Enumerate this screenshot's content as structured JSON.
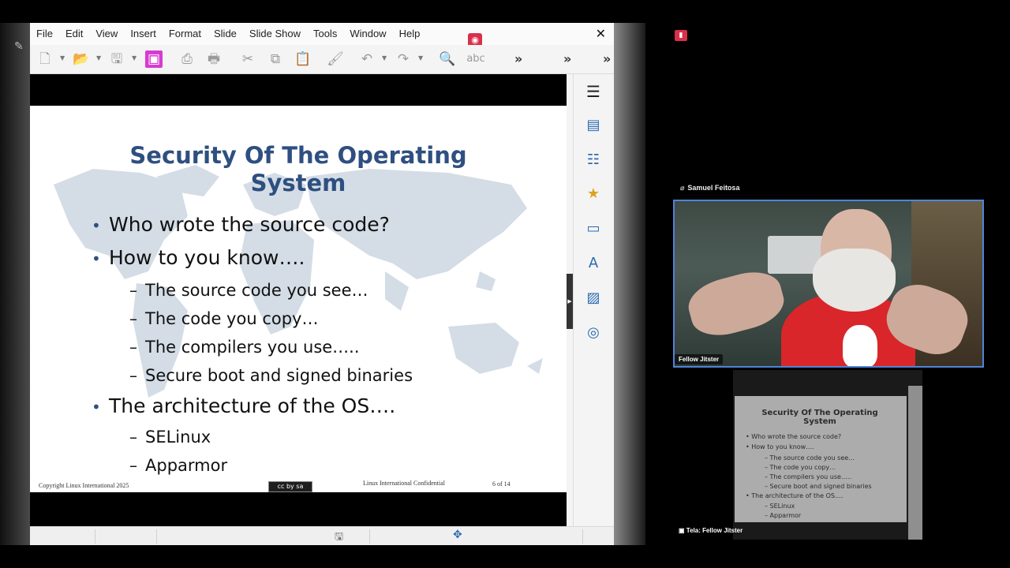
{
  "menubar": {
    "items": [
      "File",
      "Edit",
      "View",
      "Insert",
      "Format",
      "Slide",
      "Slide Show",
      "Tools",
      "Window",
      "Help"
    ],
    "close_glyph": "✕"
  },
  "toolbar": {
    "more_glyph": "»",
    "icons": [
      "new-icon",
      "open-folder-icon",
      "save-icon",
      "template-icon",
      "export-pdf-icon",
      "print-icon",
      "cut-icon",
      "copy-icon",
      "paste-icon",
      "clone-formatting-icon",
      "undo-icon",
      "redo-icon",
      "find-replace-icon",
      "spelling-icon"
    ],
    "spelling_text": "abc"
  },
  "slide": {
    "title": "Security Of The Operating System",
    "bullets": [
      {
        "level": 1,
        "text": "Who wrote the source code?"
      },
      {
        "level": 1,
        "text": "How to you know…."
      },
      {
        "level": 2,
        "text": "The  source code you see…"
      },
      {
        "level": 2,
        "text": "The code you copy…"
      },
      {
        "level": 2,
        "text": "The compilers you use….."
      },
      {
        "level": 2,
        "text": "Secure boot and signed binaries"
      },
      {
        "level": 1,
        "text": "The architecture of the OS…."
      },
      {
        "level": 2,
        "text": "SELinux"
      },
      {
        "level": 2,
        "text": "Apparmor"
      }
    ],
    "bullet_mark": "•",
    "sub_mark": "–",
    "footer_left": "Copyright Linux International 2025",
    "footer_mid": "Linux International Confidential",
    "footer_page": "6 of 14",
    "cc_badge": "cc by sa",
    "accent_color": "#2e4f80"
  },
  "sidebar": {
    "icons": [
      "sidebar-menu-icon",
      "properties-icon",
      "styles-icon",
      "animation-icon",
      "slide-transition-icon",
      "master-slides-icon",
      "gallery-icon",
      "navigator-icon"
    ]
  },
  "jitsi": {
    "speaker_name": "Samuel Feitosa",
    "video_label": "Fellow Jitster",
    "share_label": "Tela: Fellow Jitster",
    "accent_color": "#4d84d9"
  }
}
